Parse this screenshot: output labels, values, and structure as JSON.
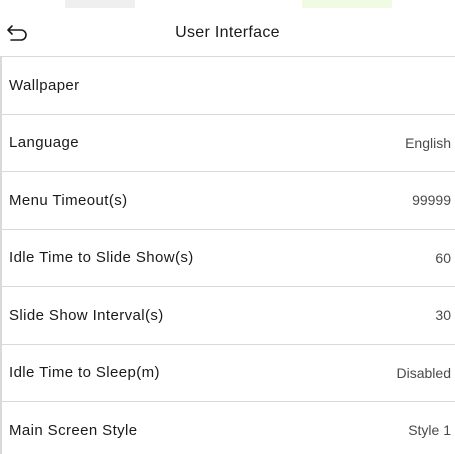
{
  "header": {
    "title": "User Interface",
    "back_icon": "back-arrow-icon"
  },
  "settings": [
    {
      "label": "Wallpaper",
      "value": ""
    },
    {
      "label": "Language",
      "value": "English"
    },
    {
      "label": "Menu Timeout(s)",
      "value": "99999"
    },
    {
      "label": "Idle Time to Slide Show(s)",
      "value": "60"
    },
    {
      "label": "Slide Show Interval(s)",
      "value": "30"
    },
    {
      "label": "Idle Time to Sleep(m)",
      "value": "Disabled"
    },
    {
      "label": "Main Screen Style",
      "value": "Style 1"
    }
  ],
  "colors": {
    "divider": "#d9d9d9",
    "text": "#1a1a1a",
    "value_text": "#4a4a4a"
  }
}
